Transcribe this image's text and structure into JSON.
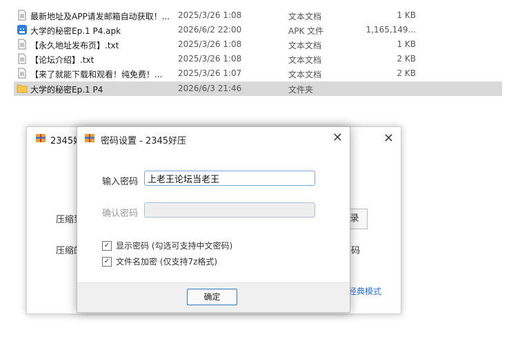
{
  "files": [
    {
      "name": "最新地址及APP请发邮箱自动获取！...",
      "date": "2025/3/26 1:08",
      "type": "文本文档",
      "size": "1 KB",
      "icon": "text-file-icon"
    },
    {
      "name": "大学的秘密Ep.1 P4.apk",
      "date": "2026/6/2 22:00",
      "type": "APK 文件",
      "size": "1,165,149...",
      "icon": "apk-file-icon"
    },
    {
      "name": "【永久地址发布页】.txt",
      "date": "2025/3/26 1:08",
      "type": "文本文档",
      "size": "1 KB",
      "icon": "text-file-icon"
    },
    {
      "name": "【论坛介绍】.txt",
      "date": "2025/3/26 1:08",
      "type": "文本文档",
      "size": "2 KB",
      "icon": "text-file-icon"
    },
    {
      "name": "【来了就能下载和观看！纯免费！...",
      "date": "2025/3/26 1:07",
      "type": "文本文档",
      "size": "2 KB",
      "icon": "text-file-icon"
    },
    {
      "name": "大学的秘密Ep.1 P4",
      "date": "2026/6/3 21:46",
      "type": "文件夹",
      "size": "",
      "icon": "folder-icon"
    }
  ],
  "bg_dialog": {
    "title": "2345好",
    "label1": "压缩到",
    "label2": "压缩的",
    "button_label": "录",
    "right_text": "码",
    "link_text": "经典模式"
  },
  "password_dialog": {
    "title": "密码设置 - 2345好压",
    "password_label": "输入密码",
    "password_value": "上老王论坛当老王",
    "confirm_label": "确认密码",
    "confirm_value": "",
    "show_password_label": "显示密码 (勾选可支持中文密码)",
    "show_password_checked": true,
    "encrypt_names_label": "文件名加密 (仅支持7z格式)",
    "encrypt_names_checked": true,
    "ok_label": "确定"
  },
  "colors": {
    "selected_row": "#d9d9d9",
    "link": "#2e6fd1",
    "input_border": "#7aa7d8"
  }
}
